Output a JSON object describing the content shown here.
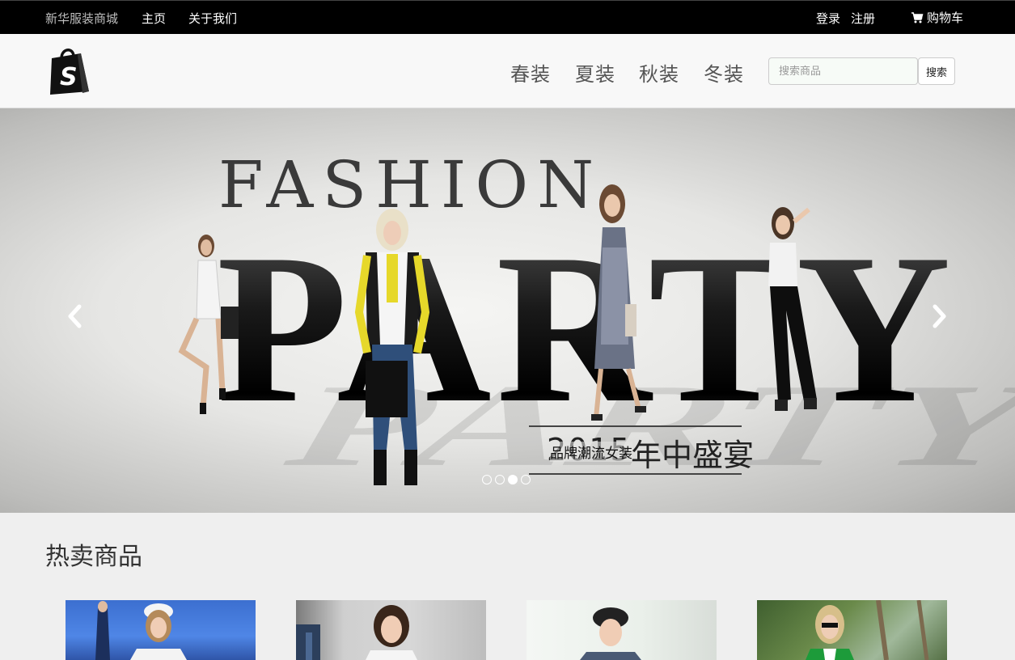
{
  "topbar": {
    "brand": "新华服装商城",
    "nav": [
      "主页",
      "关于我们"
    ],
    "login": "登录",
    "register": "注册",
    "cart": "购物车"
  },
  "header": {
    "categories": [
      "春装",
      "夏装",
      "秋装",
      "冬装"
    ],
    "search_placeholder": "搜索商品",
    "search_button": "搜索",
    "logo_letter": "S"
  },
  "carousel": {
    "headline_top": "FASHION",
    "headline_main": "PARTY",
    "promo_year": "2015",
    "promo_small": "品牌潮流女装",
    "promo_big": "年中盛宴",
    "slide_count": 4,
    "active_slide": 3
  },
  "section": {
    "title": "热卖商品"
  },
  "colors": {
    "topbar_bg": "#000000",
    "header_bg": "#f8f8f8",
    "page_bg": "#efefef"
  },
  "icons": [
    "shopping-bag-logo-icon",
    "cart-icon",
    "chevron-left-icon",
    "chevron-right-icon"
  ]
}
